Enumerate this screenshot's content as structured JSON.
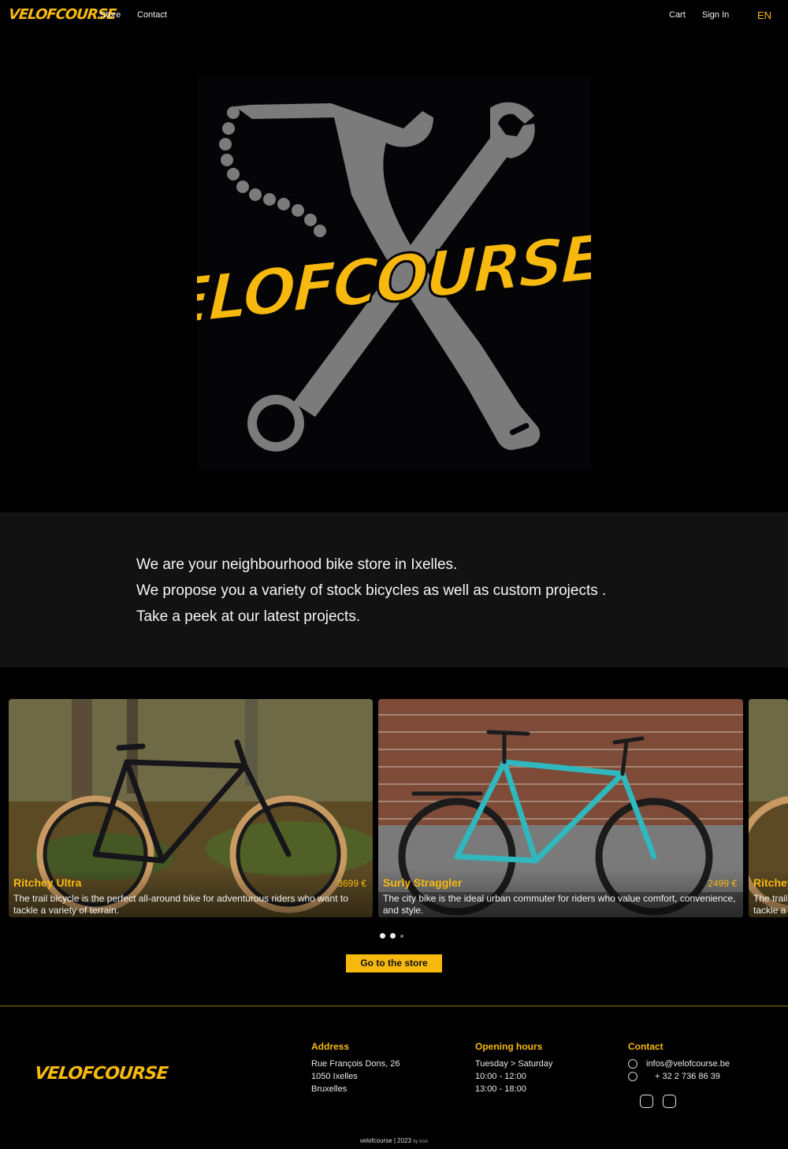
{
  "nav": {
    "logo": "VELOFCOURSE",
    "links": [
      "Store",
      "Contact"
    ],
    "right_links": [
      "Cart",
      "Sign In"
    ],
    "lang": "EN"
  },
  "hero": {
    "logo_text": "VELOFCOURSE"
  },
  "intro": {
    "lines": [
      "We are your neighbourhood bike store in Ixelles.",
      "We propose you a variety of stock bicycles as well as custom projects .",
      "Take a peek at our latest projects."
    ]
  },
  "carousel": {
    "cards": [
      {
        "title": "Ritchey Ultra",
        "price": "3699 €",
        "description": "The trail bicycle is the perfect all-around bike for adventurous riders who want to tackle a variety of terrain."
      },
      {
        "title": "Surly Straggler",
        "price": "2499 €",
        "description": "The city bike is the ideal urban commuter for riders who value comfort, convenience, and style."
      },
      {
        "title": "Ritchey Ultra",
        "price": "",
        "description": "The trail bicycle is the perfect all-around bike for adventurous riders who want to tackle a variety of terrain."
      }
    ],
    "pager_count": 3,
    "active_page": 1
  },
  "cta": {
    "label": "Go to the store"
  },
  "footer": {
    "logo": "VELOFCOURSE",
    "address": {
      "heading": "Address",
      "lines": [
        "Rue François Dons, 26",
        "1050 Ixelles",
        "Bruxelles"
      ]
    },
    "hours": {
      "heading": "Opening hours",
      "lines": [
        "Tuesday > Saturday",
        "10:00 - 12:00",
        "13:00 - 18:00"
      ]
    },
    "contact": {
      "heading": "Contact",
      "email": "infos@velofcourse.be",
      "phone": "+ 32 2 736 86 39",
      "email_icon": "mail-icon",
      "phone_icon": "phone-icon"
    },
    "social_icons": [
      "instagram-icon",
      "facebook-icon"
    ],
    "copyright": "velofcourse | 2023",
    "credit": "by tcsn"
  },
  "colors": {
    "accent": "#f8b90f",
    "background": "#000000",
    "band": "#121212",
    "tool_grey": "#7b7b7b"
  }
}
